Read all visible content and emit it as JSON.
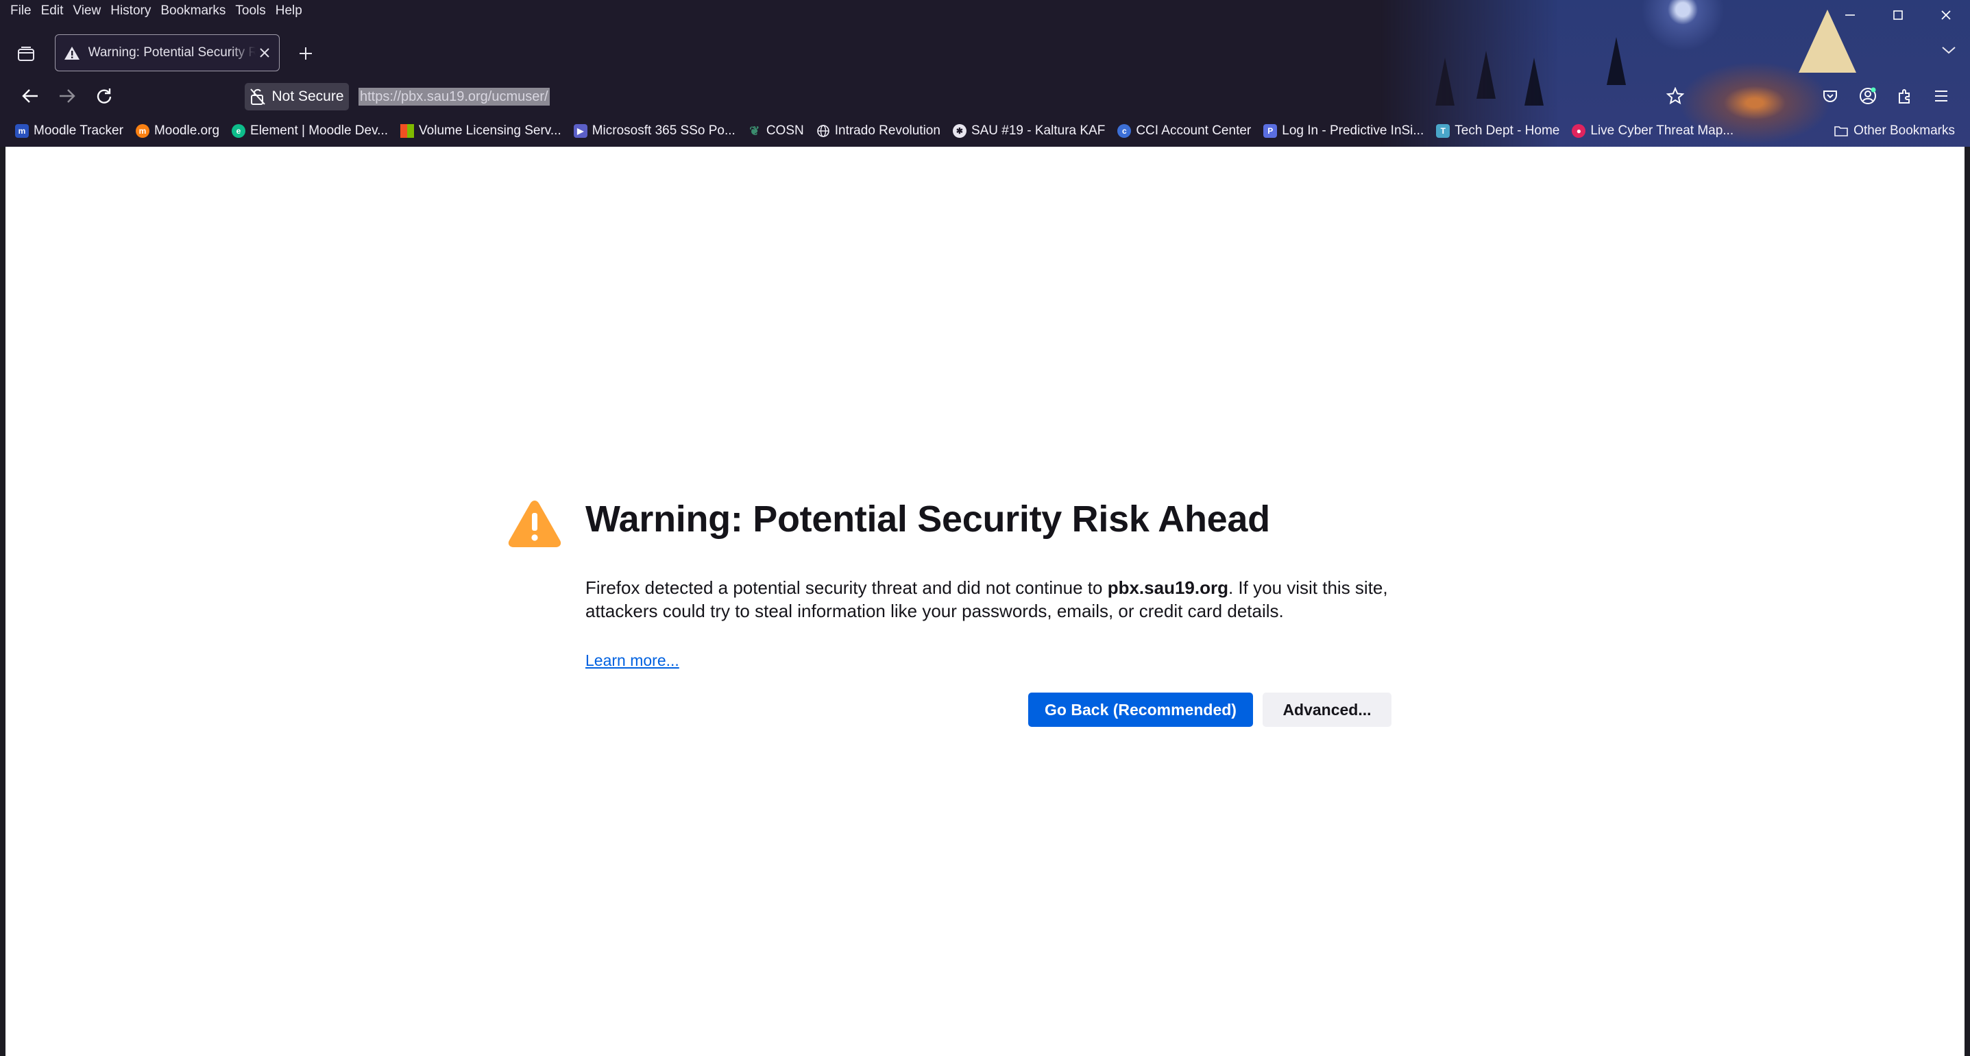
{
  "menubar": {
    "items": [
      "File",
      "Edit",
      "View",
      "History",
      "Bookmarks",
      "Tools",
      "Help"
    ]
  },
  "tab": {
    "title": "Warning: Potential Security Risk Ahead",
    "icon": "warning-icon"
  },
  "navbar": {
    "identity_label": "Not Secure",
    "url": "https://pbx.sau19.org/ucmuser/"
  },
  "bookmarks": {
    "items": [
      {
        "label": "Moodle Tracker",
        "icon": "moodle-tracker-icon",
        "color": "#2a52be"
      },
      {
        "label": "Moodle.org",
        "icon": "moodle-icon",
        "color": "#f98012"
      },
      {
        "label": "Element | Moodle Dev...",
        "icon": "element-icon",
        "color": "#0dbd8b"
      },
      {
        "label": "Volume Licensing Serv...",
        "icon": "microsoft-icon",
        "color": "#f25022"
      },
      {
        "label": "Micrososft 365 SSo Po...",
        "icon": "play-icon",
        "color": "#5b5fc7"
      },
      {
        "label": "COSN",
        "icon": "cosn-icon",
        "color": "#3b8c6e"
      },
      {
        "label": "Intrado Revolution",
        "icon": "globe-icon",
        "color": "#1e1a2a"
      },
      {
        "label": "SAU #19 - Kaltura KAF",
        "icon": "kaltura-icon",
        "color": "#e8e6ef"
      },
      {
        "label": "CCI Account Center",
        "icon": "cci-icon",
        "color": "#3c6fd6"
      },
      {
        "label": "Log In - Predictive InSi...",
        "icon": "predictive-icon",
        "color": "#5a6ee0"
      },
      {
        "label": "Tech Dept - Home",
        "icon": "tech-dept-icon",
        "color": "#49a6c9"
      },
      {
        "label": "Live Cyber Threat Map...",
        "icon": "threat-map-icon",
        "color": "#e0245e"
      }
    ],
    "other_label": "Other Bookmarks"
  },
  "error_page": {
    "title": "Warning: Potential Security Risk Ahead",
    "desc_part1": "Firefox detected a potential security threat and did not continue to ",
    "desc_host": "pbx.sau19.org",
    "desc_part2": ". If you visit this site, attackers could try to steal information like your passwords, emails, or credit card details.",
    "learn_more": "Learn more...",
    "go_back_label": "Go Back (Recommended)",
    "advanced_label": "Advanced..."
  },
  "colors": {
    "accent": "#0061e0",
    "warning": "#ffa436",
    "chrome_bg": "#1e1a2a"
  }
}
